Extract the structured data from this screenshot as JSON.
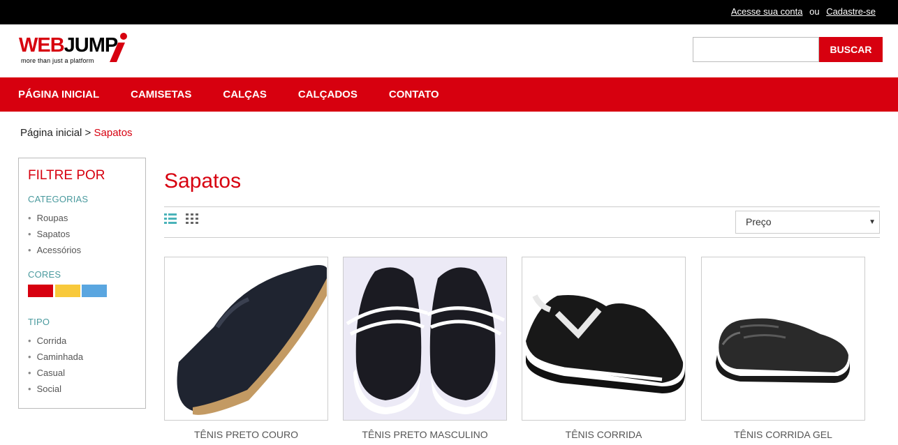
{
  "topbar": {
    "login": "Acesse sua conta",
    "or": "ou",
    "signup": "Cadastre-se"
  },
  "logo": {
    "web": "WEB",
    "jump": "JUMP",
    "tagline": "more than just a platform"
  },
  "search": {
    "placeholder": "",
    "button": "BUSCAR"
  },
  "nav": [
    "PÁGINA INICIAL",
    "CAMISETAS",
    "CALÇAS",
    "CALÇADOS",
    "CONTATO"
  ],
  "breadcrumb": {
    "home": "Página inicial",
    "sep": " > ",
    "current": "Sapatos"
  },
  "sidebar": {
    "title": "FILTRE POR",
    "categories_label": "CATEGORIAS",
    "categories": [
      "Roupas",
      "Sapatos",
      "Acessórios"
    ],
    "colors_label": "CORES",
    "colors": [
      "#d7000f",
      "#f8c93b",
      "#5aa6e0"
    ],
    "type_label": "TIPO",
    "types": [
      "Corrida",
      "Caminhada",
      "Casual",
      "Social"
    ]
  },
  "main": {
    "title": "Sapatos",
    "sort": {
      "selected": "Preço"
    },
    "view_icons": [
      "list-view-icon",
      "grid-view-icon"
    ]
  },
  "products": [
    {
      "name": "TÊNIS PRETO COURO"
    },
    {
      "name": "TÊNIS PRETO MASCULINO"
    },
    {
      "name": "TÊNIS CORRIDA"
    },
    {
      "name": "TÊNIS CORRIDA GEL"
    }
  ]
}
